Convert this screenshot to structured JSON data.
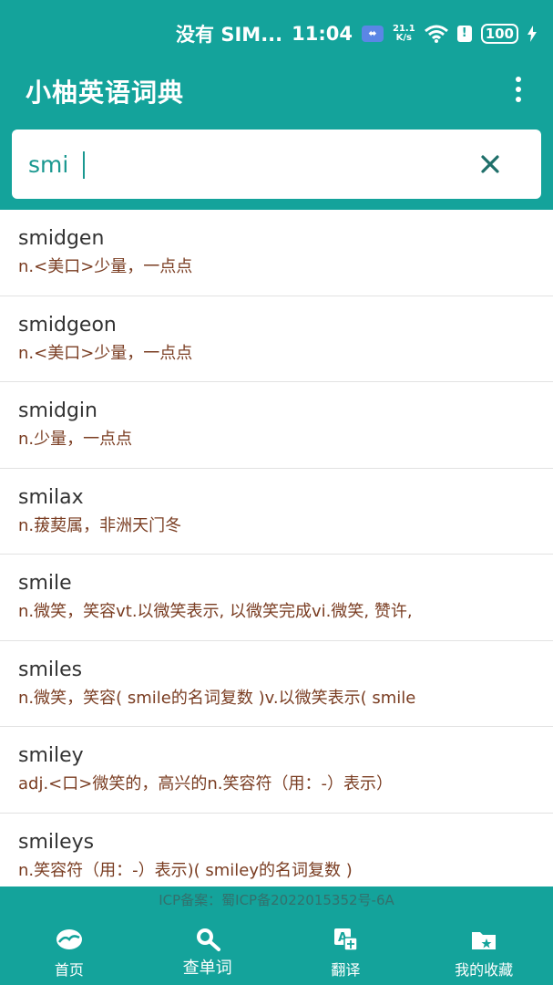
{
  "status_bar": {
    "carrier": "没有 SIM...",
    "time": "11:04",
    "usb_label": "⬌",
    "net_speed_value": "21.1",
    "net_speed_unit": "K/s",
    "battery": "100"
  },
  "app_bar": {
    "title": "小柚英语词典"
  },
  "search": {
    "value": "smi",
    "clear_label": "×"
  },
  "results": [
    {
      "word": "smidgen",
      "meaning": "n.<美口>少量，一点点"
    },
    {
      "word": "smidgeon",
      "meaning": "n.<美口>少量，一点点"
    },
    {
      "word": "smidgin",
      "meaning": "n.少量，一点点"
    },
    {
      "word": "smilax",
      "meaning": "n.菝葜属，非洲天门冬"
    },
    {
      "word": "smile",
      "meaning": "n.微笑，笑容vt.以微笑表示, 以微笑完成vi.微笑, 赞许,"
    },
    {
      "word": "smiles",
      "meaning": "n.微笑，笑容( smile的名词复数 )v.以微笑表示( smile"
    },
    {
      "word": "smiley",
      "meaning": "adj.<口>微笑的，高兴的n.笑容符（用：-）表示）"
    },
    {
      "word": "smileys",
      "meaning": "n.笑容符（用：-）表示)( smiley的名词复数 )"
    }
  ],
  "footer": {
    "icp": "ICP备案：蜀ICP备2022015352号-6A"
  },
  "tabs": [
    {
      "label": "首页",
      "icon": "home-icon"
    },
    {
      "label": "查单词",
      "icon": "search-word-icon",
      "active": true
    },
    {
      "label": "翻译",
      "icon": "translate-icon"
    },
    {
      "label": "我的收藏",
      "icon": "favorites-icon"
    }
  ],
  "colors": {
    "primary": "#14a39b",
    "word_text": "#333333",
    "meaning_text": "#7a3d22",
    "divider": "#e2e2e2"
  }
}
